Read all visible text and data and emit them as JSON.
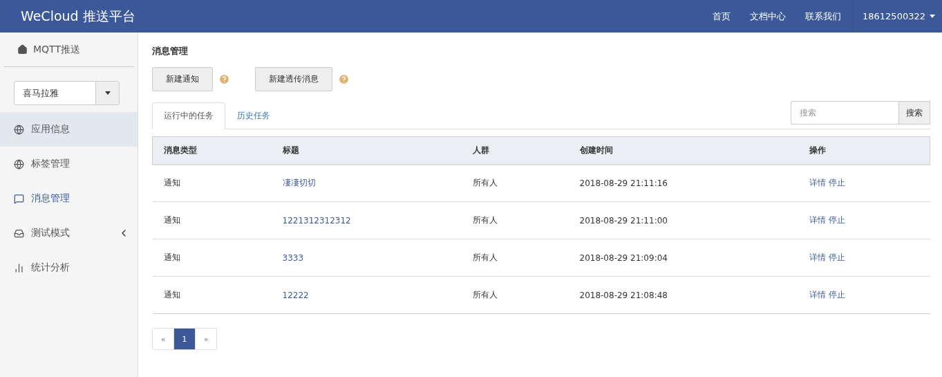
{
  "header": {
    "brand": "WeCloud 推送平台",
    "nav": [
      "首页",
      "文档中心",
      "联系我们"
    ],
    "user": "18612500322"
  },
  "sidebar": {
    "top": "MQTT推送",
    "app_select": "喜马拉雅",
    "items": [
      {
        "label": "应用信息",
        "selected": true,
        "active": false
      },
      {
        "label": "标签管理",
        "selected": false,
        "active": false
      },
      {
        "label": "消息管理",
        "selected": false,
        "active": true
      },
      {
        "label": "测试模式",
        "selected": false,
        "active": false,
        "expanded": false
      },
      {
        "label": "统计分析",
        "selected": false,
        "active": false
      }
    ]
  },
  "page_title": "消息管理",
  "actions": [
    "新建通知",
    "新建透传消息"
  ],
  "tabs": [
    {
      "label": "运行中的任务",
      "selected": true
    },
    {
      "label": "历史任务",
      "selected": false
    }
  ],
  "search": {
    "placeholder": "搜索",
    "button": "搜索"
  },
  "table": {
    "columns": [
      "消息类型",
      "标题",
      "人群",
      "创建时间",
      "操作"
    ],
    "rows": [
      {
        "type": "通知",
        "title": "凄凄切切",
        "audience": "所有人",
        "created": "2018-08-29 21:11:16",
        "ops": [
          "详情",
          "停止"
        ]
      },
      {
        "type": "通知",
        "title": "1221312312312",
        "audience": "所有人",
        "created": "2018-08-29 21:11:00",
        "ops": [
          "详情",
          "停止"
        ]
      },
      {
        "type": "通知",
        "title": "3333",
        "audience": "所有人",
        "created": "2018-08-29 21:09:04",
        "ops": [
          "详情",
          "停止"
        ]
      },
      {
        "type": "通知",
        "title": "12222",
        "audience": "所有人",
        "created": "2018-08-29 21:08:48",
        "ops": [
          "详情",
          "停止"
        ]
      }
    ]
  },
  "pagination": {
    "prev": "«",
    "pages": [
      {
        "label": "1",
        "selected": true
      }
    ],
    "next": "»"
  }
}
